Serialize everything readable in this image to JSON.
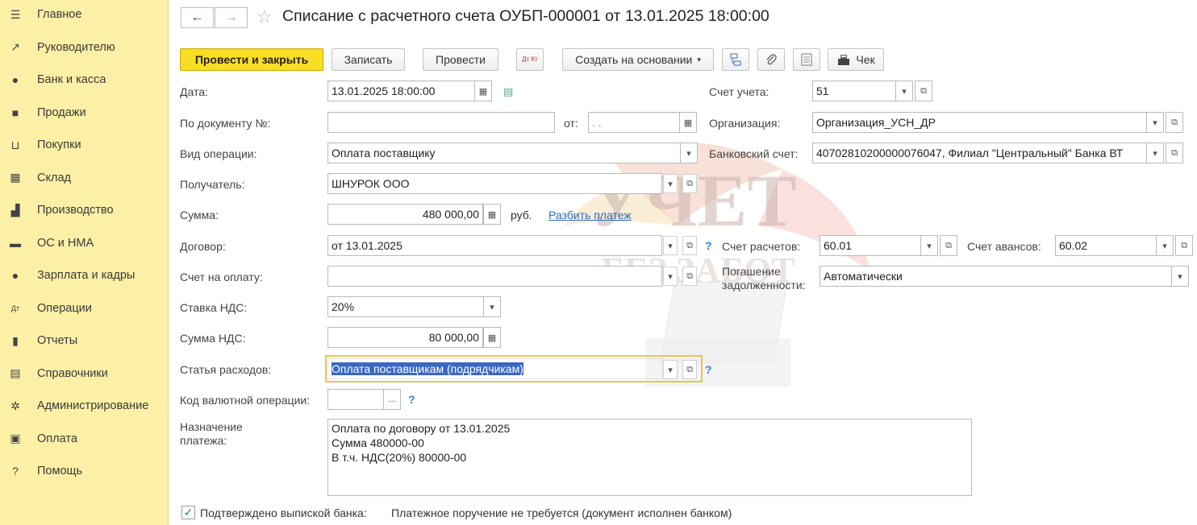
{
  "sidebar": {
    "items": [
      {
        "label": "Главное",
        "icon": "menu-icon",
        "glyph": "☰"
      },
      {
        "label": "Руководителю",
        "icon": "trend-icon",
        "glyph": "↗"
      },
      {
        "label": "Банк и касса",
        "icon": "coin-icon",
        "glyph": "●"
      },
      {
        "label": "Продажи",
        "icon": "bag-icon",
        "glyph": "■"
      },
      {
        "label": "Покупки",
        "icon": "cart-icon",
        "glyph": "⊔"
      },
      {
        "label": "Склад",
        "icon": "grid-icon",
        "glyph": "▦"
      },
      {
        "label": "Производство",
        "icon": "factory-icon",
        "glyph": "▟"
      },
      {
        "label": "ОС и НМА",
        "icon": "truck-icon",
        "glyph": "▬"
      },
      {
        "label": "Зарплата и кадры",
        "icon": "person-icon",
        "glyph": "●"
      },
      {
        "label": "Операции",
        "icon": "dt-kt-icon",
        "glyph": "Дт"
      },
      {
        "label": "Отчеты",
        "icon": "bar-chart-icon",
        "glyph": "▮"
      },
      {
        "label": "Справочники",
        "icon": "books-icon",
        "glyph": "▤"
      },
      {
        "label": "Администрирование",
        "icon": "gear-icon",
        "glyph": "✲"
      },
      {
        "label": "Оплата",
        "icon": "wallet-icon",
        "glyph": "▣"
      },
      {
        "label": "Помощь",
        "icon": "question-icon",
        "glyph": "?"
      }
    ]
  },
  "header": {
    "back": "←",
    "forward": "→",
    "star": "☆",
    "title": "Списание с расчетного счета ОУБП-000001 от 13.01.2025 18:00:00"
  },
  "toolbar": {
    "post_close": "Провести и закрыть",
    "save": "Записать",
    "post": "Провести",
    "dt_kt": "Дт Кт",
    "create_based": "Создать на основании",
    "receipt": "Чек"
  },
  "form": {
    "date_label": "Дата:",
    "date_value": "13.01.2025 18:00:00",
    "docnum_label": "По документу №:",
    "docnum_value": "",
    "from_label": "от:",
    "from_value": " .  .",
    "optype_label": "Вид операции:",
    "optype_value": "Оплата поставщику",
    "recipient_label": "Получатель:",
    "recipient_value": "ШНУРОК ООО",
    "sum_label": "Сумма:",
    "sum_value": "480 000,00",
    "currency": "руб.",
    "split_link": "Разбить платеж",
    "contract_label": "Договор:",
    "contract_value": "от 13.01.2025",
    "invoice_label": "Счет на оплату:",
    "invoice_value": "",
    "vat_rate_label": "Ставка НДС:",
    "vat_rate_value": "20%",
    "vat_sum_label": "Сумма НДС:",
    "vat_sum_value": "80 000,00",
    "expense_label": "Статья расходов:",
    "expense_value": "Оплата поставщикам (подрядчикам)",
    "currency_op_label": "Код валютной операции:",
    "currency_op_value": "",
    "purpose_label": "Назначение платежа:",
    "purpose_value": "Оплата по договору от 13.01.2025\nСумма 480000-00\nВ т.ч. НДС(20%) 80000-00",
    "account_label": "Счет учета:",
    "account_value": "51",
    "org_label": "Организация:",
    "org_value": "Организация_УСН_ДР",
    "bank_label": "Банковский счет:",
    "bank_value": "40702810200000076047, Филиал \"Центральный\" Банка ВТ",
    "settle_label": "Счет расчетов:",
    "settle_value": "60.01",
    "advance_label": "Счет авансов:",
    "advance_value": "60.02",
    "repay_label": "Погашение задолженности:",
    "repay_value": "Автоматически",
    "confirmed_label": "Подтверждено выпиской банка:",
    "confirmed_checked": true,
    "confirmed_note": "Платежное поручение не требуется (документ исполнен банком)"
  },
  "watermark": {
    "line1": "УЧЕТ",
    "line2": "БЕЗ ЗАБОТ"
  },
  "colors": {
    "sidebar": "#fbf0a6",
    "primary": "#f9de26",
    "link": "#2b6cb8",
    "focus": "#e8c64a"
  }
}
